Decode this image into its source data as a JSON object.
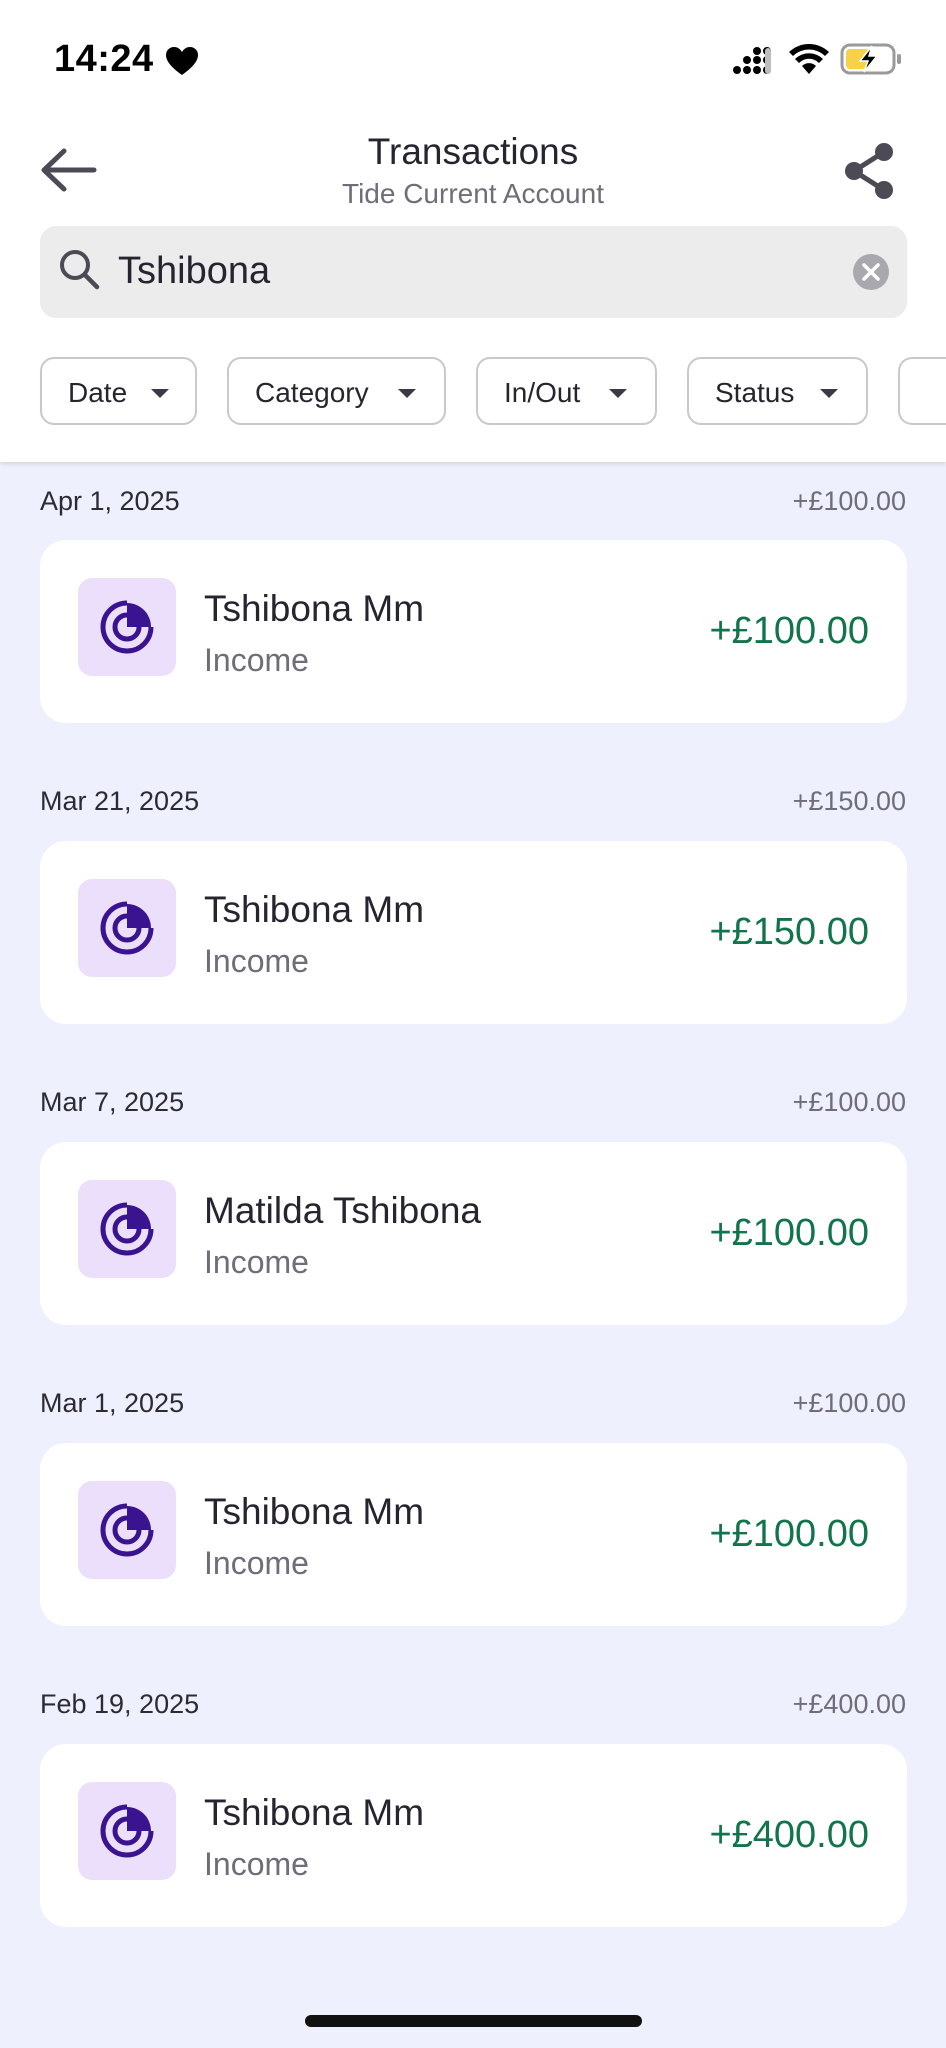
{
  "status_bar": {
    "time": "14:24"
  },
  "header": {
    "title": "Transactions",
    "subtitle": "Tide Current Account"
  },
  "search": {
    "value": "Tshibona"
  },
  "filters": [
    "Date",
    "Category",
    "In/Out",
    "Status"
  ],
  "groups": [
    {
      "date": "Apr 1, 2025",
      "total": "+£100.00",
      "transaction": {
        "name": "Tshibona Mm",
        "category": "Income",
        "amount": "+£100.00"
      }
    },
    {
      "date": "Mar 21, 2025",
      "total": "+£150.00",
      "transaction": {
        "name": "Tshibona Mm",
        "category": "Income",
        "amount": "+£150.00"
      }
    },
    {
      "date": "Mar 7, 2025",
      "total": "+£100.00",
      "transaction": {
        "name": "Matilda Tshibona",
        "category": "Income",
        "amount": "+£100.00"
      }
    },
    {
      "date": "Mar 1, 2025",
      "total": "+£100.00",
      "transaction": {
        "name": "Tshibona Mm",
        "category": "Income",
        "amount": "+£100.00"
      }
    },
    {
      "date": "Feb 19, 2025",
      "total": "+£400.00",
      "transaction": {
        "name": "Tshibona Mm",
        "category": "Income",
        "amount": "+£400.00"
      }
    }
  ],
  "colors": {
    "income_amount": "#12744a",
    "brand_purple": "#3a1490",
    "avatar_background": "#ecdffb",
    "list_background": "#eef1fd",
    "battery_charging": "#f7d247"
  },
  "icons": {
    "back": "arrow-left-icon",
    "share": "share-icon",
    "search": "search-icon",
    "clear": "clear-icon",
    "dropdown": "caret-down-icon",
    "transaction": "income-chart-icon"
  }
}
